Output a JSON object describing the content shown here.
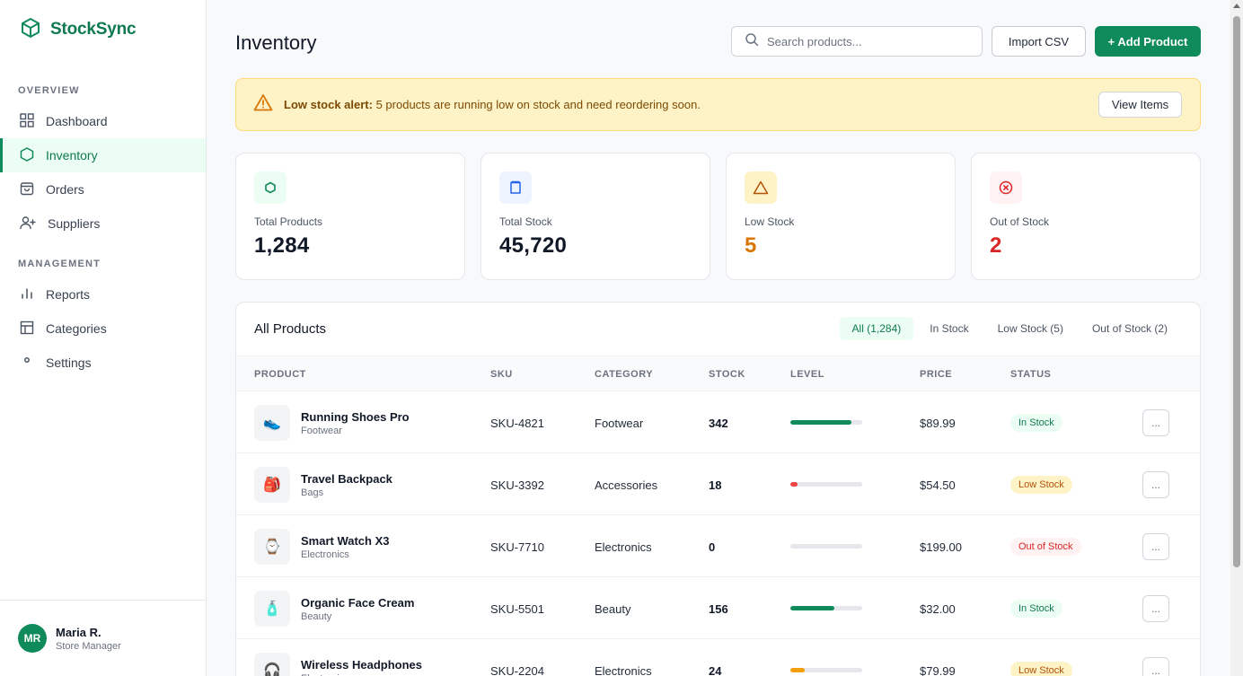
{
  "brand": {
    "name": "StockSync",
    "accent": "#0f8a5a"
  },
  "sidebar": {
    "sections": [
      "OVERVIEW",
      "MANAGEMENT"
    ],
    "overview_items": [
      {
        "label": "Dashboard",
        "icon": "grid-icon"
      },
      {
        "label": "Inventory",
        "icon": "hexagon-icon",
        "active": true
      },
      {
        "label": "Orders",
        "icon": "bag-icon"
      },
      {
        "label": "Suppliers",
        "icon": "user-plus-icon"
      }
    ],
    "management_items": [
      {
        "label": "Reports",
        "icon": "bar-chart-icon"
      },
      {
        "label": "Categories",
        "icon": "table-icon"
      },
      {
        "label": "Settings",
        "icon": "dot-icon"
      }
    ],
    "user": {
      "initials": "MR",
      "name": "Maria R.",
      "role": "Store Manager"
    }
  },
  "header": {
    "title": "Inventory",
    "search_placeholder": "Search products...",
    "import_label": "Import CSV",
    "add_label": "+ Add Product"
  },
  "alert": {
    "bold": "Low stock alert:",
    "text": " 5 products are running low on stock and need reordering soon.",
    "button": "View Items"
  },
  "stats": [
    {
      "label": "Total Products",
      "value": "1,284",
      "color": "#111827"
    },
    {
      "label": "Total Stock",
      "value": "45,720",
      "color": "#111827"
    },
    {
      "label": "Low Stock",
      "value": "5",
      "color": "#d97706"
    },
    {
      "label": "Out of Stock",
      "value": "2",
      "color": "#dc2626"
    }
  ],
  "table": {
    "title": "All Products",
    "filters": [
      "All (1,284)",
      "In Stock",
      "Low Stock (5)",
      "Out of Stock (2)"
    ],
    "columns": [
      "PRODUCT",
      "SKU",
      "CATEGORY",
      "STOCK",
      "LEVEL",
      "PRICE",
      "STATUS"
    ],
    "rows": [
      {
        "name": "Running Shoes Pro",
        "sub": "Footwear",
        "sku": "SKU-4821",
        "category": "Footwear",
        "stock": "342",
        "level": 0.85,
        "price": "$89.99",
        "status": "In Stock",
        "emoji": "👟"
      },
      {
        "name": "Travel Backpack",
        "sub": "Bags",
        "sku": "SKU-3392",
        "category": "Accessories",
        "stock": "18",
        "level": 0.1,
        "price": "$54.50",
        "status": "Low Stock",
        "emoji": "🎒"
      },
      {
        "name": "Smart Watch X3",
        "sub": "Electronics",
        "sku": "SKU-7710",
        "category": "Electronics",
        "stock": "0",
        "level": 0,
        "price": "$199.00",
        "status": "Out of Stock",
        "emoji": "⌚"
      },
      {
        "name": "Organic Face Cream",
        "sub": "Beauty",
        "sku": "SKU-5501",
        "category": "Beauty",
        "stock": "156",
        "level": 0.61,
        "price": "$32.00",
        "status": "In Stock",
        "emoji": "🧴"
      },
      {
        "name": "Wireless Headphones",
        "sub": "Electronics",
        "sku": "SKU-2204",
        "category": "Electronics",
        "stock": "24",
        "level": 0.2,
        "price": "$79.99",
        "status": "Low Stock",
        "emoji": "🎧"
      }
    ],
    "more_label": "..."
  }
}
